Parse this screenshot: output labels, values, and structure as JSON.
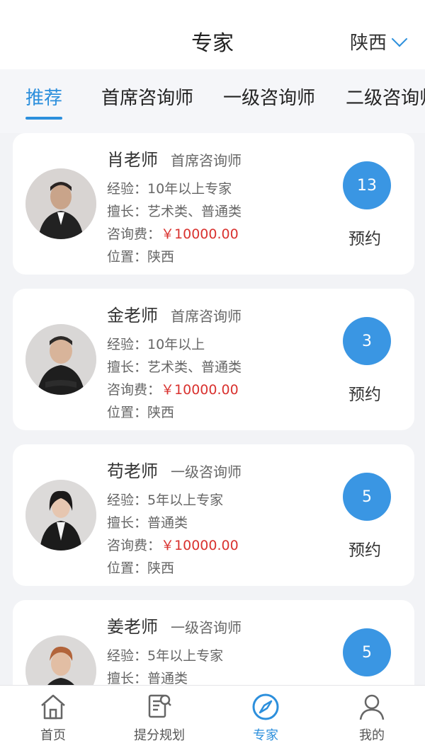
{
  "header": {
    "title": "专家",
    "region": "陕西"
  },
  "tabs": [
    {
      "label": "推荐",
      "active": true
    },
    {
      "label": "首席咨询师"
    },
    {
      "label": "一级咨询师"
    },
    {
      "label": "二级咨询师"
    }
  ],
  "experts": [
    {
      "name": "肖老师",
      "level": "首席咨询师",
      "experience": "经验：10年以上专家",
      "specialty": "擅长：艺术类、普通类",
      "fee_label": "咨询费：",
      "fee": "￥10000.00",
      "location": "位置：陕西",
      "count": "13",
      "book_label": "预约"
    },
    {
      "name": "金老师",
      "level": "首席咨询师",
      "experience": "经验：10年以上",
      "specialty": "擅长：艺术类、普通类",
      "fee_label": "咨询费：",
      "fee": "￥10000.00",
      "location": "位置：陕西",
      "count": "3",
      "book_label": "预约"
    },
    {
      "name": "苟老师",
      "level": "一级咨询师",
      "experience": "经验：5年以上专家",
      "specialty": "擅长：普通类",
      "fee_label": "咨询费：",
      "fee": "￥10000.00",
      "location": "位置：陕西",
      "count": "5",
      "book_label": "预约"
    },
    {
      "name": "姜老师",
      "level": "一级咨询师",
      "experience": "经验：5年以上专家",
      "specialty": "擅长：普通类",
      "count": "5"
    }
  ],
  "nav": [
    {
      "label": "首页",
      "icon": "home-icon"
    },
    {
      "label": "提分规划",
      "icon": "plan-doc-icon"
    },
    {
      "label": "专家",
      "icon": "compass-icon",
      "active": true
    },
    {
      "label": "我的",
      "icon": "user-icon"
    }
  ],
  "colors": {
    "accent": "#2c8fdc",
    "badge": "#3a96e3",
    "price": "#d9322f"
  }
}
